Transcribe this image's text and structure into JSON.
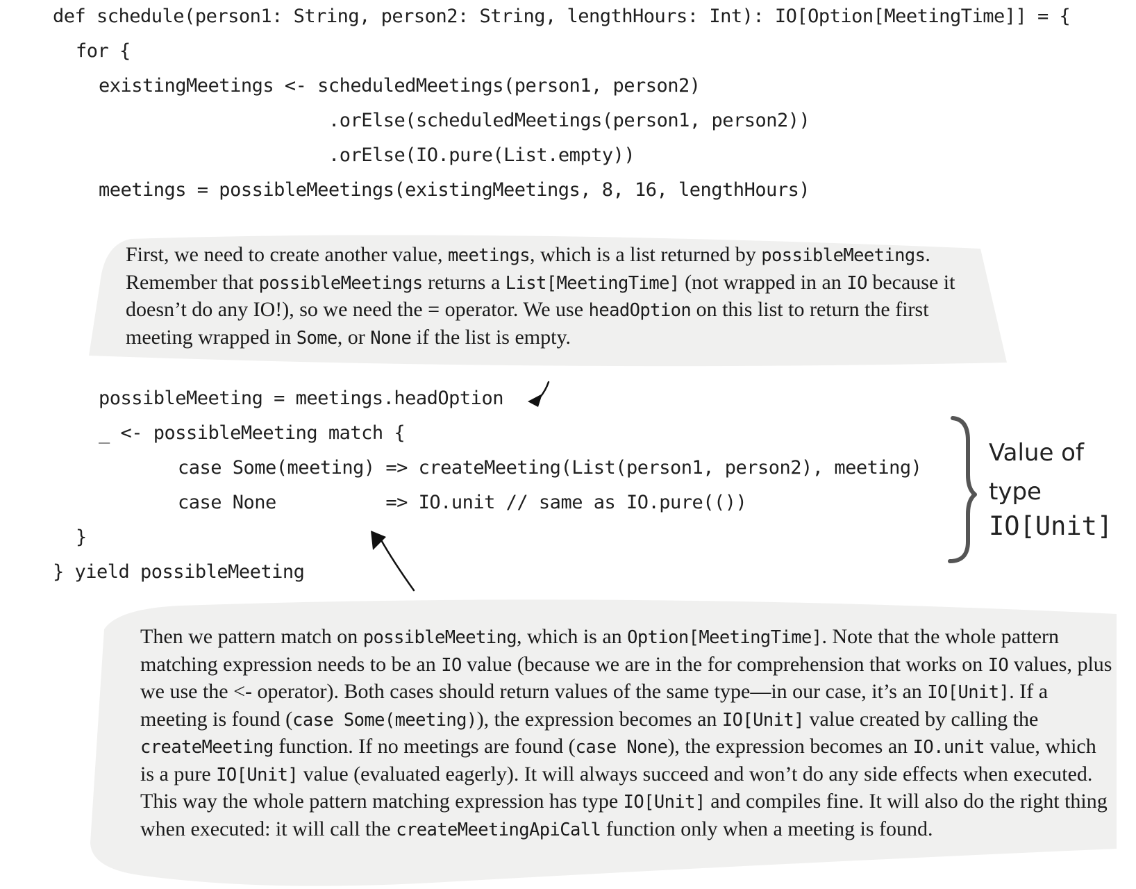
{
  "code": {
    "line1": "def schedule(person1: String, person2: String, lengthHours: Int): IO[Option[MeetingTime]] = {",
    "line2": "for {",
    "line3": "existingMeetings <- scheduledMeetings(person1, person2)",
    "line4": ".orElse(scheduledMeetings(person1, person2))",
    "line5": ".orElse(IO.pure(List.empty))",
    "line6": "meetings = possibleMeetings(existingMeetings, 8, 16, lengthHours)",
    "line7": "possibleMeeting = meetings.headOption",
    "line8": "_ <- possibleMeeting match {",
    "line9": "case Some(meeting) => createMeeting(List(person1, person2), meeting)",
    "line10": "case None          => IO.unit // same as IO.pure(())",
    "line11": "}",
    "line12": "} yield possibleMeeting"
  },
  "callout1": {
    "t1": "First, we need to create another value, ",
    "c1": "meetings",
    "t2": ", which is a list returned by ",
    "c2": "possibleMeetings",
    "t3": ". Remember that ",
    "c3": "possibleMeetings",
    "t4": " returns a ",
    "c4": "List[MeetingTime]",
    "t5": " (not wrapped in an ",
    "c5": "IO",
    "t6": " because it doesn’t do any IO!), so we need the = operator. We use ",
    "c6": "headOption",
    "t7": " on this list to return the first meeting wrapped in ",
    "c7": "Some",
    "t8": ", or ",
    "c8": "None",
    "t9": " if the list is empty."
  },
  "callout2": {
    "t1": "Then we pattern match on ",
    "c1": "possibleMeeting",
    "t2": ", which is an ",
    "c2": "Option[MeetingTime]",
    "t3": ". Note that the whole pattern matching expression needs to be an ",
    "c3": "IO",
    "t4": " value (because we are in the for comprehension that works on ",
    "c4": "IO",
    "t5": " values, plus we use the <- operator). Both cases should return values of the same type—in our case, it’s an ",
    "c5": "IO[Unit]",
    "t6": ". If a meeting is found (",
    "c6": "case Some(meeting)",
    "t7": "), the expression becomes an ",
    "c7": "IO[Unit]",
    "t8": " value created by calling the ",
    "c8": "createMeeting",
    "t9": " function. If no meetings are found (",
    "c9": "case None",
    "t10": "), the expression becomes an ",
    "c10": "IO.unit",
    "t11": " value, which is a pure ",
    "c11": "IO[Unit]",
    "t12": " value (evaluated eagerly). It will always succeed and won’t do any side effects when executed. This way the whole pattern matching expression has type ",
    "c12": "IO[Unit]",
    "t13": " and compiles fine. It will also do the right thing when executed: it will call the ",
    "c13": "createMeetingApiCall",
    "t14": " function only when a meeting is found."
  },
  "annotation": {
    "line1": "Value of",
    "line2": "type",
    "line3": "IO[Unit]"
  },
  "colors": {
    "callout_background": "#f0f0ef",
    "bracket": "#555555",
    "text": "#1a1a1a"
  }
}
